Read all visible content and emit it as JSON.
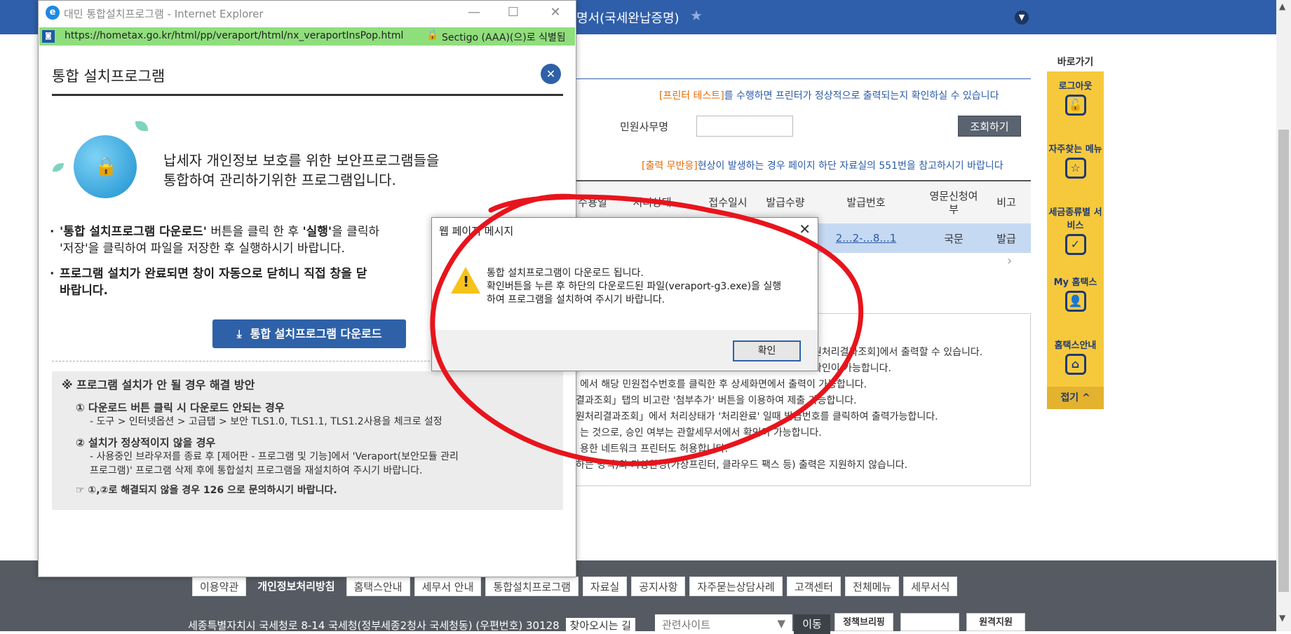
{
  "page": {
    "breadcrumb": "명서(국세완납증명)",
    "printer_notice": {
      "hl": "[프린터 테스트]",
      "rest": "를 수행하면 프린터가 정상적으로 출력되는지 확인하실 수 있습니다"
    },
    "office_label": "민원사무명",
    "search_button": "조회하기",
    "output_notice": {
      "hl": "[출력 무반응]",
      "rest": "현상이 발생하는 경우 페이지 하단 자료실의 551번을 참고하시기 바랍니다"
    },
    "table": {
      "headers": [
        "수용일",
        "처리상태",
        "접수일시",
        "발급수량",
        "발급번호",
        "영문신청여부",
        "비고"
      ],
      "row": [
        "",
        "",
        "",
        "",
        "2...2-...8...1",
        "국문",
        "발급"
      ]
    },
    "info_lines": [
      "원처리결과조회]에서 출력할 수 있습니다.",
      "확인이 가능합니다.",
      "에서 해당 민원접수번호를 클릭한 후 상세화면에서 출력이 가능합니다.",
      "결과조회」탭의 비고란 '첨부추가' 버튼을 이용하여 제출 가능합니다.",
      "원처리결과조회」에서 처리상태가 '처리완료' 일때 발급번호를 클릭하여 출력가능합니다.",
      "는 것으로, 승인 여부는 관할세무서에서 확인이 가능합니다.",
      "용한 네트워크 프린터도 허용합니다.",
      "하는 방식)와 가상환경(가상프린터, 클라우드 팩스 등) 출력은 지원하지 않습니다."
    ]
  },
  "quick_menu": {
    "title": "바로가기",
    "items": [
      {
        "label": "로그아웃",
        "icon": "unlock-icon"
      },
      {
        "label": "자주찾는 메뉴",
        "icon": "star-icon"
      },
      {
        "label": "세금종류별 서비스",
        "icon": "checkbox-icon"
      },
      {
        "label": "My 홈택스",
        "icon": "user-icon"
      },
      {
        "label": "홈택스안내",
        "icon": "home-icon"
      }
    ],
    "close": "접기 ^"
  },
  "footer": {
    "menu": [
      "이용약관",
      "개인정보처리방침",
      "홈택스안내",
      "세무서 안내",
      "통합설치프로그램",
      "자료실",
      "공지사항",
      "자주묻는상담사례",
      "고객센터",
      "전체메뉴",
      "세무서식"
    ],
    "address": "세종특별자치시 국세청로 8-14 국세청(정부세종2청사 국세청동) (우편번호) 30128",
    "directions": "찾아오시는 길",
    "related_select": "관련사이트",
    "go_button": "이동",
    "banners": [
      "정책브리핑",
      "",
      "원격지원"
    ]
  },
  "ie_window": {
    "title": "대민 통합설치프로그램 - Internet Explorer",
    "url": "https://hometax.go.kr/html/pp/veraport/html/nx_veraportInsPop.html",
    "cert": "Sectigo (AAA)(으)로 식별됨",
    "heading": "통합 설치프로그램",
    "intro_l1": "납세자 개인정보 보호를 위한 보안프로그램들을",
    "intro_l2": "통합하여 관리하기위한 프로그램입니다.",
    "list1": {
      "b1": "'통합 설치프로그램 다운로드'",
      "t1": " 버튼을 클릭 한 후 ",
      "b2": "'실행'",
      "t2": "을 클릭하",
      "l2": "'저장'을 클릭하여 파일을 저장한 후 실행하시기 바랍니다."
    },
    "list2": {
      "l1": "프로그램 설치가 완료되면 창이 자동으로 닫히니 직접 창을 닫",
      "l2": "바랍니다."
    },
    "download_button": "통합 설치프로그램 다운로드",
    "help": {
      "title": "※ 프로그램 설치가 안 될 경우 해결 방안",
      "q1": "① 다운로드 버튼 클릭 시 다운로드 안되는 경우",
      "a1": "- 도구 > 인터넷옵션 > 고급탭 > 보안 TLS1.0, TLS1.1, TLS1.2사용을 체크로 설정",
      "q2": "② 설치가 정상적이지 않을 경우",
      "a2_l1": "- 사용중인 브라우저를 종료 후 [제어판 - 프로그램 및 기능]에서 'Veraport(보안모듈 관리",
      "a2_l2": "  프로그램)' 프로그램 삭제 후에 통합설치 프로그램을 재설치하여 주시기 바랍니다.",
      "last": "☞ ①,②로 해결되지 않을 경우 126 으로 문의하시기 바랍니다."
    }
  },
  "dialog": {
    "title": "웹 페이지 메시지",
    "line1": "통합 설치프로그램이 다운로드 됩니다.",
    "line2": "확인버튼을 누른 후 하단의 다운로드된 파일(veraport-g3.exe)을 실행",
    "line3": "하여 프로그램을 설치하여 주시기 바랍니다.",
    "ok": "확인"
  },
  "colors": {
    "brand": "#2f5faa",
    "quick": "#f6c93d",
    "annotation": "#e8141c"
  }
}
